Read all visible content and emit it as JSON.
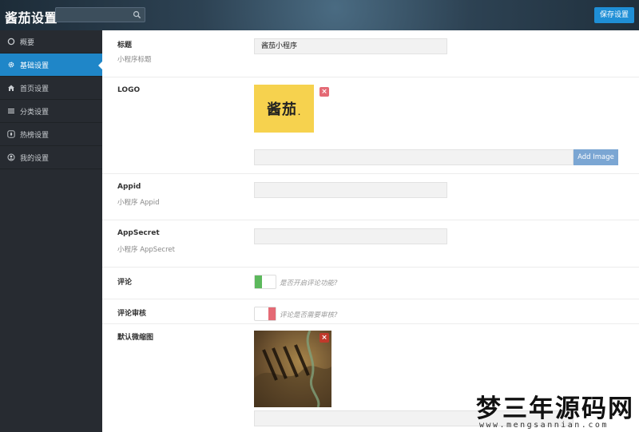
{
  "header": {
    "title": "酱茄设置",
    "search_placeholder": "",
    "save_label": "保存设置"
  },
  "sidebar": {
    "items": [
      {
        "label": "概要",
        "icon": "circle-icon",
        "active": false
      },
      {
        "label": "基础设置",
        "icon": "gear-icon",
        "active": true
      },
      {
        "label": "首页设置",
        "icon": "home-icon",
        "active": false
      },
      {
        "label": "分类设置",
        "icon": "list-icon",
        "active": false
      },
      {
        "label": "热榜设置",
        "icon": "fire-icon",
        "active": false
      },
      {
        "label": "我的设置",
        "icon": "user-circle-icon",
        "active": false
      }
    ]
  },
  "form": {
    "title": {
      "label": "标题",
      "sub": "小程序标题",
      "value": "酱茄小程序"
    },
    "logo": {
      "label": "LOGO",
      "logo_text": "酱茄",
      "logo_dot": ".",
      "add_label": "Add Image",
      "delete": "×"
    },
    "appid": {
      "label": "Appid",
      "sub": "小程序 Appid",
      "value": ""
    },
    "appsecret": {
      "label": "AppSecret",
      "sub": "小程序 AppSecret",
      "value": ""
    },
    "comment": {
      "label": "评论",
      "hint": "是否开启评论功能?",
      "color": "#5cb85c"
    },
    "comment_review": {
      "label": "评论审核",
      "hint": "评论是否需要审核?",
      "color": "#e46a75"
    },
    "default_thumb": {
      "label": "默认微缩图",
      "delete": "×"
    }
  },
  "watermark": {
    "title": "梦三年源码网",
    "url": "www.mengsannian.com"
  },
  "colors": {
    "accent": "#1f86c8",
    "sidebar_bg": "#272b31",
    "button_blue": "#1f8fd6"
  }
}
